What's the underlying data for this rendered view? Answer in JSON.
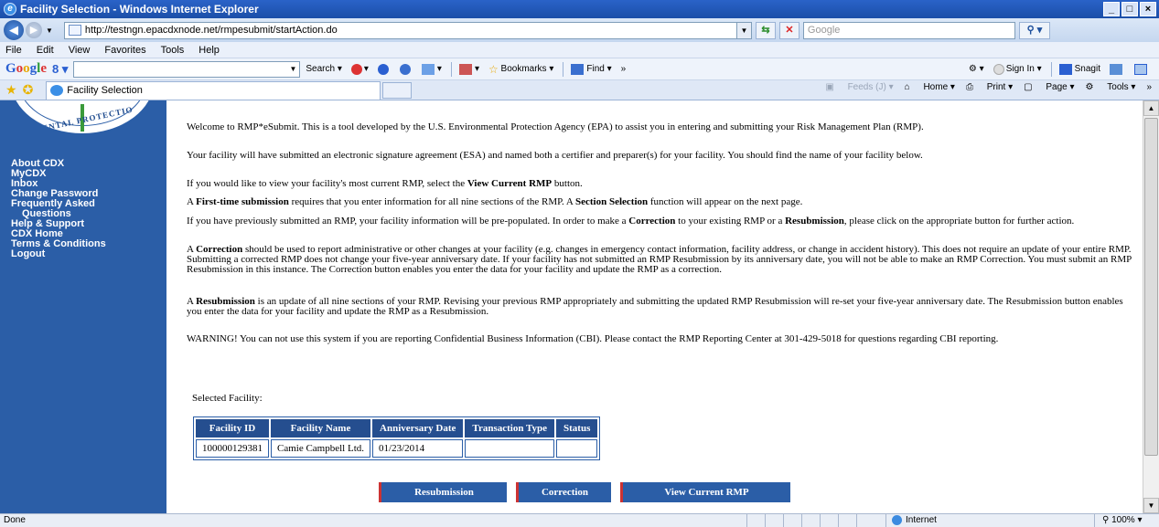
{
  "window": {
    "title": "Facility Selection - Windows Internet Explorer",
    "controls": [
      "_",
      "□",
      "×"
    ]
  },
  "address_bar": {
    "url": "http://testngn.epacdxnode.net/rmpesubmit/startAction.do",
    "search_placeholder": "Google"
  },
  "menu": [
    "File",
    "Edit",
    "View",
    "Favorites",
    "Tools",
    "Help"
  ],
  "google_toolbar": {
    "logo": "Google",
    "search_label": "Search",
    "bookmarks_label": "Bookmarks",
    "find_label": "Find",
    "more": "»",
    "sign_in": "Sign In",
    "snagit": "Snagit"
  },
  "tabs": [
    {
      "label": "Facility Selection"
    }
  ],
  "command_bar": {
    "feeds": "Feeds (J)",
    "home": "Home",
    "print": "Print",
    "page": "Page",
    "tools": "Tools"
  },
  "sidebar": {
    "seal_text": "MENTAL PROTECTIO",
    "links": [
      {
        "label": "About CDX",
        "indent": false
      },
      {
        "label": "MyCDX",
        "indent": false
      },
      {
        "label": "Inbox",
        "indent": false
      },
      {
        "label": "Change Password",
        "indent": false
      },
      {
        "label": "Frequently Asked",
        "indent": false
      },
      {
        "label": "Questions",
        "indent": true
      },
      {
        "label": "Help & Support",
        "indent": false
      },
      {
        "label": "CDX Home",
        "indent": false
      },
      {
        "label": "Terms & Conditions",
        "indent": false
      },
      {
        "label": "Logout",
        "indent": false
      }
    ]
  },
  "main": {
    "paragraphs": [
      {
        "parts": [
          {
            "t": "Welcome to RMP*eSubmit. This is a tool developed by the U.S. Environmental Protection Agency (EPA) to assist you in entering and submitting your Risk Management Plan (RMP).",
            "b": false
          }
        ]
      },
      {
        "parts": [
          {
            "t": "Your facility will have submitted an electronic signature agreement (ESA) and named both a certifier and preparer(s) for your facility. You should find the name of your facility below.",
            "b": false
          }
        ]
      },
      {
        "parts": [
          {
            "t": "If you would like to view your facility's most current RMP, select the ",
            "b": false
          },
          {
            "t": "View Current RMP",
            "b": true
          },
          {
            "t": " button.",
            "b": false
          }
        ]
      },
      {
        "parts": [
          {
            "t": "A ",
            "b": false
          },
          {
            "t": "First-time submission",
            "b": true
          },
          {
            "t": " requires that you enter information for all nine sections of the RMP. A ",
            "b": false
          },
          {
            "t": "Section Selection",
            "b": true
          },
          {
            "t": " function will appear on the next page.",
            "b": false
          }
        ]
      },
      {
        "parts": [
          {
            "t": "If you have previously submitted an RMP, your facility information will be pre-populated. In order to make a ",
            "b": false
          },
          {
            "t": "Correction",
            "b": true
          },
          {
            "t": " to your existing RMP or a ",
            "b": false
          },
          {
            "t": "Resubmission",
            "b": true
          },
          {
            "t": ", please click on the appropriate button for further action.",
            "b": false
          }
        ]
      },
      {
        "parts": [
          {
            "t": "A ",
            "b": false
          },
          {
            "t": "Correction",
            "b": true
          },
          {
            "t": " should be used to report administrative or other changes at your facility (e.g. changes in emergency contact information, facility address, or change in accident history). This does not require an update of your entire RMP. Submitting a corrected RMP does not change your five-year anniversary date. If your facility has not submitted an RMP Resubmission by its anniversary date, you will not be able to make an RMP Correction. You must submit an RMP Resubmission in this instance. The Correction button enables you enter the data for your facility and update the RMP as a correction.",
            "b": false
          }
        ]
      },
      {
        "parts": [
          {
            "t": "A ",
            "b": false
          },
          {
            "t": "Resubmission",
            "b": true
          },
          {
            "t": " is an update of all nine sections of your RMP. Revising your previous RMP appropriately and submitting the updated RMP Resubmission will re-set your five-year anniversary date. The Resubmission button enables you enter the data for your facility and update the RMP as a Resubmission.",
            "b": false
          }
        ]
      },
      {
        "parts": [
          {
            "t": "WARNING! You can not use this system if you are reporting Confidential Business Information (CBI). Please contact the RMP Reporting Center at 301-429-5018 for questions regarding CBI reporting.",
            "b": false
          }
        ]
      }
    ],
    "selected_facility_label": "Selected Facility:",
    "table": {
      "headers": [
        "Facility ID",
        "Facility Name",
        "Anniversary Date",
        "Transaction Type",
        "Status"
      ],
      "rows": [
        [
          "100000129381",
          "Camie Campbell Ltd.",
          "01/23/2014",
          "",
          ""
        ]
      ]
    },
    "buttons": {
      "resubmission": "Resubmission",
      "correction": "Correction",
      "view_current": "View Current RMP"
    }
  },
  "status_bar": {
    "status": "Done",
    "zone": "Internet",
    "zoom": "100%"
  }
}
